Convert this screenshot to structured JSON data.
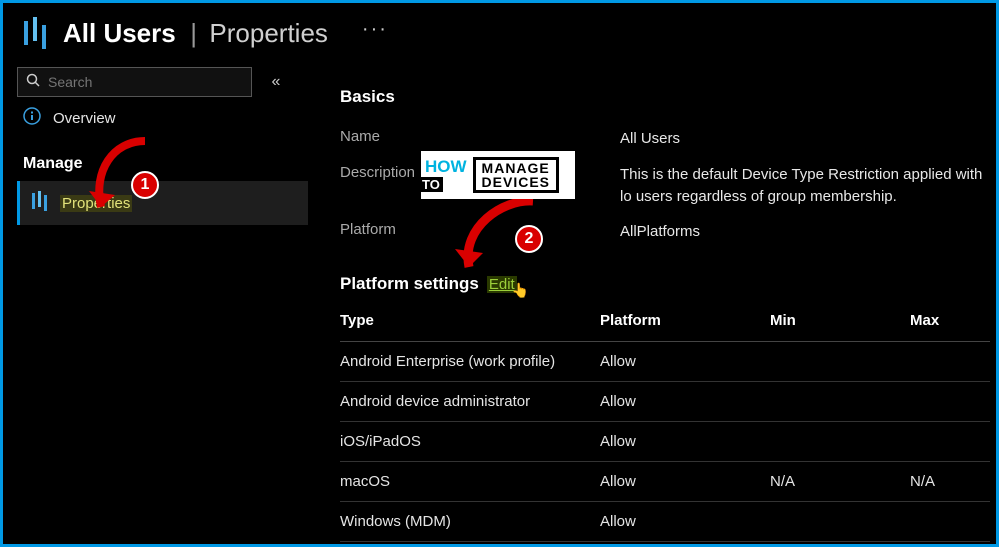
{
  "header": {
    "entity": "All Users",
    "section": "Properties",
    "more": "···"
  },
  "sidebar": {
    "search_placeholder": "Search",
    "collapse": "«",
    "overview_label": "Overview",
    "manage_label": "Manage",
    "properties_label": "Properties"
  },
  "basics": {
    "heading": "Basics",
    "fields": {
      "name": {
        "label": "Name",
        "value": "All Users"
      },
      "description": {
        "label": "Description",
        "value": "This is the default Device Type Restriction applied with lo users regardless of group membership."
      },
      "platform": {
        "label": "Platform",
        "value": "AllPlatforms"
      }
    }
  },
  "platform_settings": {
    "heading": "Platform settings",
    "edit": "Edit",
    "columns": {
      "type": "Type",
      "platform": "Platform",
      "min": "Min",
      "max": "Max"
    },
    "rows": [
      {
        "type": "Android Enterprise (work profile)",
        "platform": "Allow",
        "min": "",
        "max": ""
      },
      {
        "type": "Android device administrator",
        "platform": "Allow",
        "min": "",
        "max": ""
      },
      {
        "type": "iOS/iPadOS",
        "platform": "Allow",
        "min": "",
        "max": ""
      },
      {
        "type": "macOS",
        "platform": "Allow",
        "min": "N/A",
        "max": "N/A"
      },
      {
        "type": "Windows (MDM)",
        "platform": "Allow",
        "min": "",
        "max": ""
      }
    ]
  },
  "annotations": {
    "badge1": "1",
    "badge2": "2",
    "wm_how": "HOW",
    "wm_to": "TO",
    "wm_manage": "MANAGE",
    "wm_devices": "DEVICES"
  }
}
